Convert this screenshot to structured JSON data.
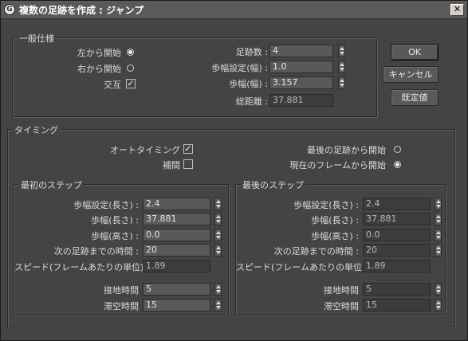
{
  "window": {
    "title": "複数の足跡を作成 : ジャンプ",
    "icon_glyph": "G",
    "close_glyph": "✕"
  },
  "general": {
    "legend": "一般仕様",
    "start_left_label": "左から開始",
    "start_right_label": "右から開始",
    "alternate_label": "交互",
    "start_left_selected": true,
    "start_right_selected": false,
    "alternate_checked": true,
    "footstep_count_label": "足跡数 :",
    "footstep_count_value": "4",
    "stride_param_label": "歩幅設定(幅) :",
    "stride_param_value": "1.0",
    "stride_width_label": "歩幅(幅) :",
    "stride_width_value": "3.157",
    "total_distance_label": "総距離 :",
    "total_distance_value": "37.881"
  },
  "buttons": {
    "ok": "OK",
    "cancel": "キャンセル",
    "defaults": "既定値"
  },
  "timing": {
    "legend": "タイミング",
    "auto_timing_label": "オートタイミング",
    "auto_timing_checked": true,
    "interpolate_label": "補間",
    "interpolate_checked": false,
    "start_after_last_label": "最後の足跡から開始",
    "start_after_last_selected": false,
    "start_current_frame_label": "現在のフレームから開始",
    "start_current_frame_selected": true
  },
  "first_step": {
    "legend": "最初のステップ",
    "stride_param_label": "歩幅設定(長さ) :",
    "stride_param_value": "2.4",
    "stride_length_label": "歩幅(長さ) :",
    "stride_length_value": "37.881",
    "stride_height_label": "歩幅(高さ) :",
    "stride_height_value": "0.0",
    "time_to_next_label": "次の足跡までの時間 :",
    "time_to_next_value": "20",
    "speed_label": "スピード(フレームあたりの単位) :",
    "speed_value": "1.89",
    "ground_time_label": "接地時間",
    "ground_time_value": "5",
    "air_time_label": "滞空時間",
    "air_time_value": "15"
  },
  "last_step": {
    "legend": "最後のステップ",
    "stride_param_label": "歩幅設定(長さ) :",
    "stride_param_value": "2.4",
    "stride_length_label": "歩幅(長さ) :",
    "stride_length_value": "37.881",
    "stride_height_label": "歩幅(高さ) :",
    "stride_height_value": "0.0",
    "time_to_next_label": "次の足跡までの時間 :",
    "time_to_next_value": "20",
    "speed_label": "スピード(フレームあたりの単位) :",
    "speed_value": "1.89",
    "ground_time_label": "接地時間",
    "ground_time_value": "5",
    "air_time_label": "滞空時間",
    "air_time_value": "15"
  }
}
